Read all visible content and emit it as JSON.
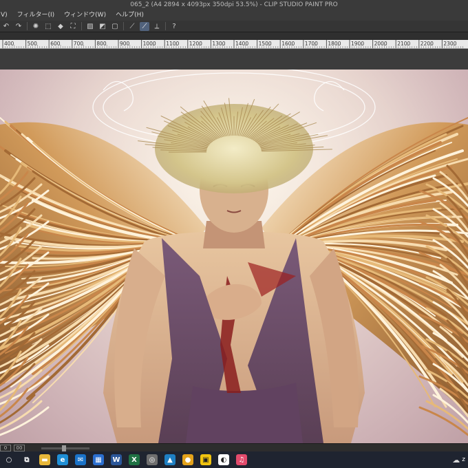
{
  "window": {
    "title": "065_2 (A4 2894 x 4093px 350dpi 53.5%) - CLIP STUDIO PAINT PRO"
  },
  "menu": [
    "V)",
    "フィルター(I)",
    "ウィンドウ(W)",
    "ヘルプ(H)"
  ],
  "command_bar": {
    "buttons": [
      {
        "name": "undo-icon",
        "glyph": "↶"
      },
      {
        "name": "redo-icon",
        "glyph": "↷"
      },
      {
        "name": "spinner-icon",
        "glyph": "✺"
      },
      {
        "name": "clear-icon",
        "glyph": "⬚"
      },
      {
        "name": "fill-icon",
        "glyph": "◆"
      },
      {
        "name": "transform-icon",
        "glyph": "⛶"
      },
      {
        "name": "deselect-icon",
        "glyph": "▨"
      },
      {
        "name": "invert-selection-icon",
        "glyph": "◩"
      },
      {
        "name": "crop-icon",
        "glyph": "▢"
      },
      {
        "name": "ruler-snap-icon",
        "glyph": "⟋",
        "active": false
      },
      {
        "name": "special-ruler-snap-icon",
        "glyph": "⟋",
        "active": true
      },
      {
        "name": "grid-snap-icon",
        "glyph": "⟂"
      },
      {
        "name": "help-icon",
        "glyph": "?"
      }
    ]
  },
  "ruler": {
    "labels": [
      "400",
      "500",
      "600",
      "700",
      "800",
      "900",
      "1000",
      "1100",
      "1200",
      "1300",
      "1400",
      "1500",
      "1600",
      "1700",
      "1800",
      "1900",
      "2000",
      "2100",
      "2200",
      "2300"
    ]
  },
  "statusbar": {
    "left_label": "0",
    "box_label": "00"
  },
  "taskbar": {
    "apps": [
      {
        "name": "start-icon",
        "glyph": "○",
        "color": "#1f2430"
      },
      {
        "name": "task-view-icon",
        "glyph": "⧉",
        "color": "#1f2430"
      },
      {
        "name": "file-explorer-icon",
        "glyph": "▬",
        "color": "#e8b83a"
      },
      {
        "name": "edge-icon",
        "glyph": "e",
        "color": "#1f8fd6"
      },
      {
        "name": "mail-icon",
        "glyph": "✉",
        "color": "#1a73c9"
      },
      {
        "name": "store-icon",
        "glyph": "▦",
        "color": "#2b6fd0"
      },
      {
        "name": "word-icon",
        "glyph": "W",
        "color": "#2b579a"
      },
      {
        "name": "excel-icon",
        "glyph": "X",
        "color": "#1f7244"
      },
      {
        "name": "settings-app-icon",
        "glyph": "◎",
        "color": "#6f6f6f"
      },
      {
        "name": "photos-icon",
        "glyph": "▲",
        "color": "#1e7fc2"
      },
      {
        "name": "chrome-icon",
        "glyph": "●",
        "color": "#e3a21a"
      },
      {
        "name": "sticky-notes-icon",
        "glyph": "▣",
        "color": "#f1c40f"
      },
      {
        "name": "clip-studio-icon",
        "glyph": "◐",
        "color": "#ffffff"
      },
      {
        "name": "itunes-icon",
        "glyph": "♫",
        "color": "#e24b6c"
      }
    ],
    "tray_text": "z"
  }
}
